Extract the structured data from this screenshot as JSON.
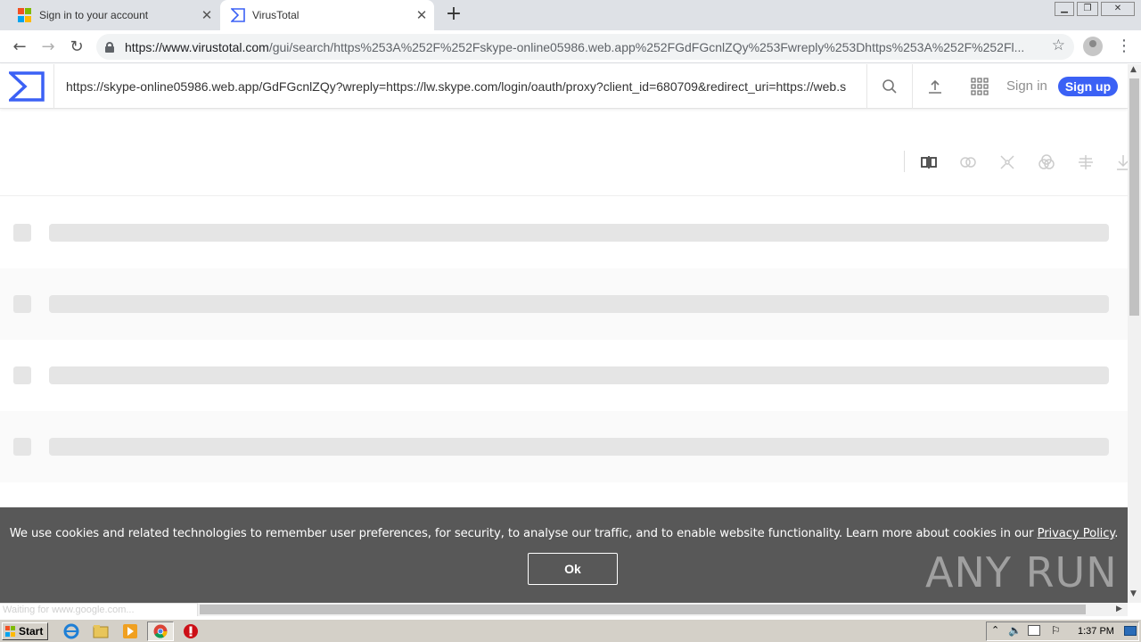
{
  "browser": {
    "tabs": [
      {
        "title": "Sign in to your account"
      },
      {
        "title": "VirusTotal"
      }
    ],
    "address_bar": {
      "host": "https://www.virustotal.com",
      "path": "/gui/search/https%253A%252F%252Fskype-online05986.web.app%252FGdFGcnlZQy%253Fwreply%253Dhttps%253A%252F%252Fl..."
    },
    "status_text": "Waiting for www.google.com..."
  },
  "vt": {
    "search_value": "https://skype-online05986.web.app/GdFGcnlZQy?wreply=https://lw.skype.com/login/oauth/proxy?client_id=680709&redirect_uri=https://web.s",
    "signin_label": "Sign in",
    "signup_label": "Sign up",
    "accent_color": "#3b61f5"
  },
  "cookie_banner": {
    "text": "We use cookies and related technologies to remember user preferences, for security, to analyse our traffic, and to enable website functionality. Learn more about cookies in our ",
    "link": "Privacy Policy",
    "suffix": ".",
    "ok_label": "Ok"
  },
  "watermark": "ANY RUN",
  "taskbar": {
    "start_label": "Start",
    "clock": "1:37 PM"
  }
}
